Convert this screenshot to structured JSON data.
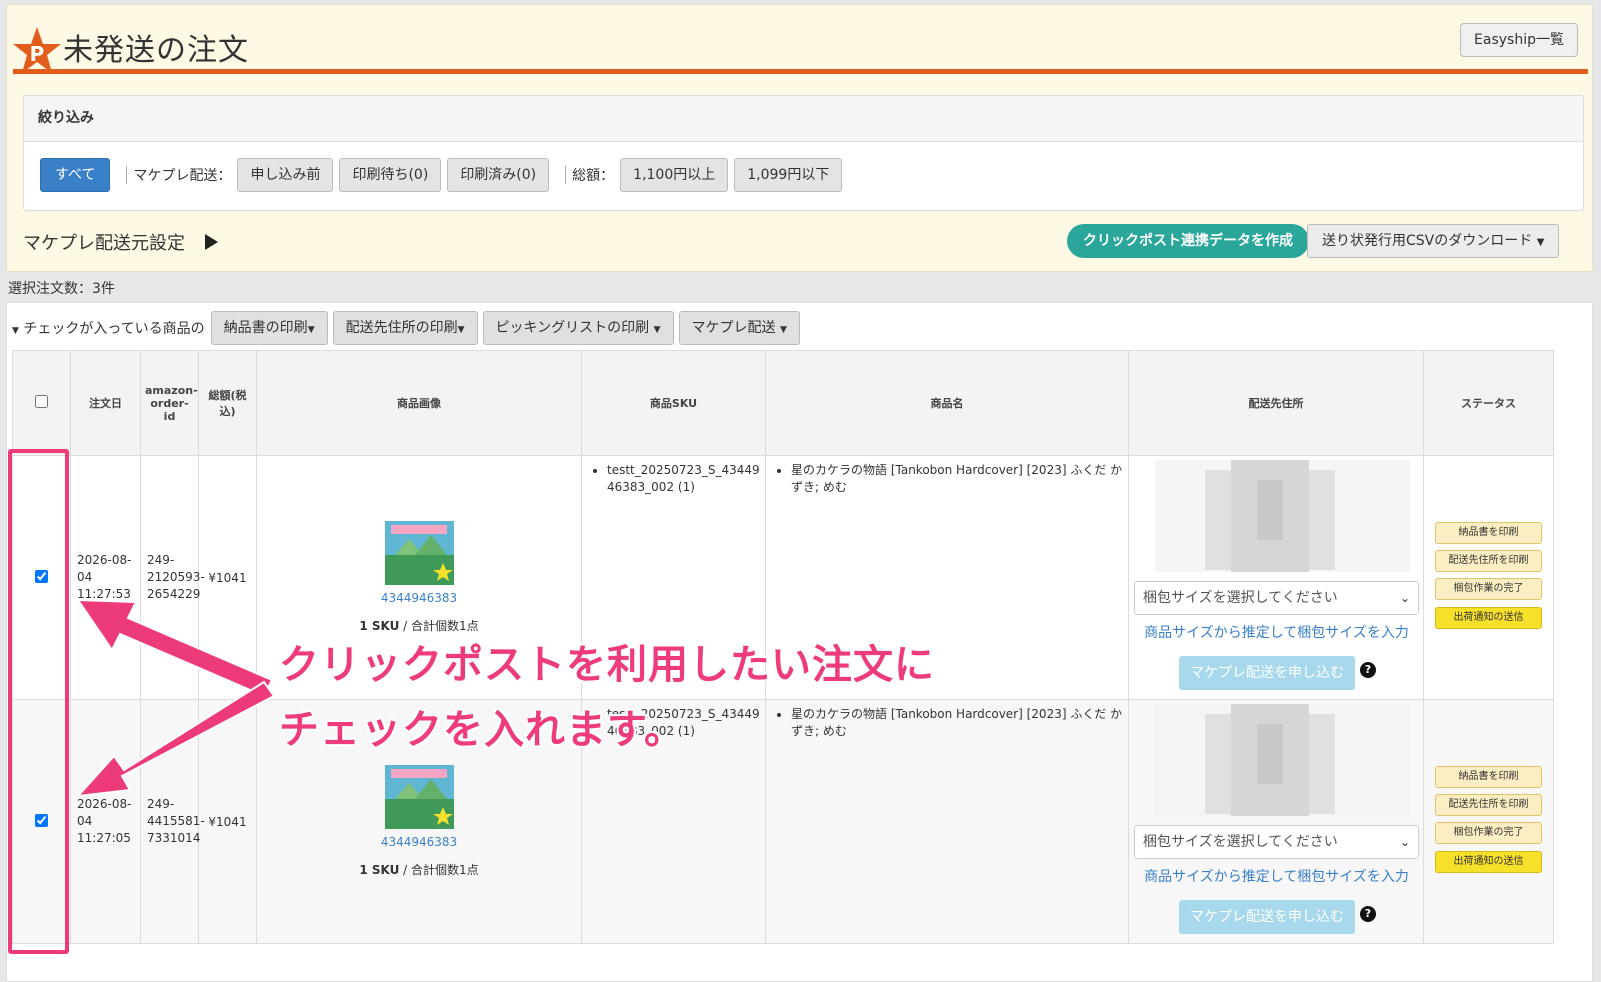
{
  "header": {
    "title": "未発送の注文",
    "easyship_button": "Easyship一覧",
    "logo_letter": "P"
  },
  "filter": {
    "heading": "絞り込み",
    "all_label": "すべて",
    "makepure_label": "マケプレ配送：",
    "status_buttons": [
      "申し込み前",
      "印刷待ち(0)",
      "印刷済み(0)"
    ],
    "amount_label": "総額：",
    "amount_buttons": [
      "1,100円以上",
      "1,099円以下"
    ]
  },
  "shipping": {
    "origin_label": "マケプレ配送元設定",
    "clickpost_button": "クリックポスト連携データを作成",
    "csv_button": "送り状発行用CSVのダウンロード"
  },
  "selected_count": "選択注文数：3件",
  "actions": {
    "label": "チェックが入っている商品の",
    "buttons": [
      "納品書の印刷",
      "配送先住所の印刷",
      "ピッキングリストの印刷",
      "マケプレ配送"
    ]
  },
  "table": {
    "headers": [
      "注文日",
      "amazon-order-id",
      "総額(税込)",
      "商品画像",
      "商品SKU",
      "商品名",
      "配送先住所",
      "ステータス"
    ],
    "rows": [
      {
        "date": "2026-08-04 11:27:53",
        "order_id": "249-2120593-2654229",
        "total": "¥1041",
        "asin": "4344946383",
        "summary_sku": "1 SKU",
        "summary_qty": " / 合計個数1点",
        "sku": "testt_20250723_S_4344946383_002 (1)",
        "product_name": "星のカケラの物語 [Tankobon Hardcover] [2023] ふくだ かずき; めむ",
        "pack_select": "梱包サイズを選択してください",
        "estimate_link": "商品サイズから推定して梱包サイズを入力",
        "apply_button": "マケプレ配送を申し込む",
        "status_buttons": [
          "納品書を印刷",
          "配送先住所を印刷",
          "梱包作業の完了",
          "出荷通知の送信"
        ]
      },
      {
        "date": "2026-08-04 11:27:05",
        "order_id": "249-4415581-7331014",
        "total": "¥1041",
        "asin": "4344946383",
        "summary_sku": "1 SKU",
        "summary_qty": " / 合計個数1点",
        "sku": "testt_20250723_S_4344946383_002 (1)",
        "product_name": "星のカケラの物語 [Tankobon Hardcover] [2023] ふくだ かずき; めむ",
        "pack_select": "梱包サイズを選択してください",
        "estimate_link": "商品サイズから推定して梱包サイズを入力",
        "apply_button": "マケプレ配送を申し込む",
        "status_buttons": [
          "納品書を印刷",
          "配送先住所を印刷",
          "梱包作業の完了",
          "出荷通知の送信"
        ]
      }
    ]
  },
  "annotation": {
    "line1": "クリックポストを利用したい注文に",
    "line2": "チェックを入れます。",
    "color": "#ec3a7a"
  },
  "colors": {
    "accent_orange": "#e25d1b",
    "primary_blue": "#3a80c8",
    "teal": "#2aa69a",
    "status_yellow": "#f7e02a"
  }
}
